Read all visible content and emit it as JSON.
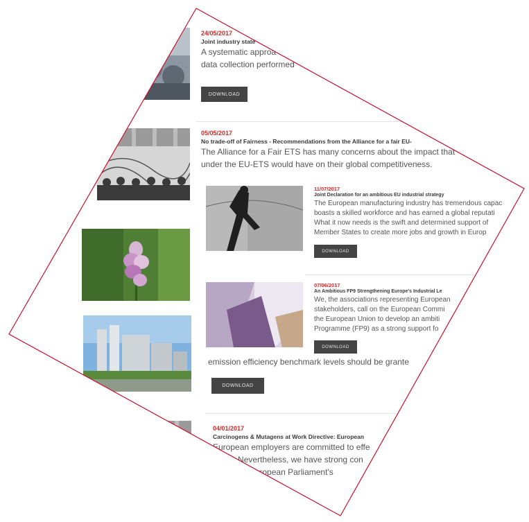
{
  "items": [
    {
      "date": "24/05/2017",
      "title": "Joint industry state",
      "body_lines": [
        "A systematic approa",
        "data collection performed"
      ],
      "button": "DOWNLOAD"
    },
    {
      "date": "05/05/2017",
      "title": "No trade-off of Fairness - Recommendations from the Alliance for a fair EU-",
      "body_lines": [
        "The Alliance for a Fair ETS has many concerns about the impact that",
        "under the EU-ETS would have on their global competitiveness."
      ]
    },
    {
      "date": "11/07/2017",
      "title": "Joint Declaration for an ambitious EU industrial strategy",
      "body_lines": [
        "The European manufacturing industry has tremendous capac",
        "boasts a skilled workforce and has earned a global reputati",
        "What it now needs is the swift and determined support of",
        "Member States to create more jobs and growth in Europ"
      ],
      "button": "DOWNLOAD"
    },
    {
      "date": "07/06/2017",
      "title": "An Ambitious FP9 Strengthening Europe's Industrial Le",
      "body_lines": [
        "We, the associations representing European",
        "stakeholders, call on the European Commi",
        "the European Union to develop an ambiti",
        "Programme (FP9) as a strong support fo"
      ],
      "button": "DOWNLOAD"
    },
    {
      "body_lines": [
        "emission efficiency benchmark levels should be grante"
      ],
      "button": "DOWNLOAD"
    },
    {
      "date": "04/01/2017",
      "title": "Carcinogens & Mutagens at Work Directive: European",
      "body_lines": [
        "European employers are committed to effe",
        "ancer. Nevertheless, we have strong con",
        "ed by the European Parliament's"
      ]
    }
  ]
}
